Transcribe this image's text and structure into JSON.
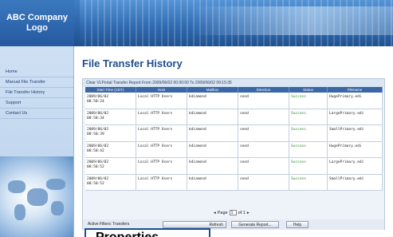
{
  "header": {
    "logo_text": "ABC Company\nLogo"
  },
  "sidebar": {
    "items": [
      {
        "label": "Home"
      },
      {
        "label": "Manual File Transfer"
      },
      {
        "label": "File Transfer History"
      },
      {
        "label": "Support"
      },
      {
        "label": "Contact Us"
      }
    ]
  },
  "main": {
    "title": "File Transfer History",
    "report_caption": "Clear VLPortal Transfer Report From 2009/06/02 00:00:00 To 2009/06/02 09:15:35",
    "columns": [
      "Start Time (CDT)",
      "Host",
      "Mailbox",
      "Direction",
      "Status",
      "Filename"
    ],
    "rows": [
      {
        "date": "2009/06/02",
        "time": "08:50:24",
        "host": "Local HTTP Users",
        "mailbox": "kdiamond",
        "direction": "send",
        "status": "Success",
        "filename": "HugePrimary.edi"
      },
      {
        "date": "2009/06/02",
        "time": "08:50:34",
        "host": "Local HTTP Users",
        "mailbox": "kdiamond",
        "direction": "send",
        "status": "Success",
        "filename": "LargePrimary.edi"
      },
      {
        "date": "2009/06/02",
        "time": "08:50:39",
        "host": "Local HTTP Users",
        "mailbox": "kdiamond",
        "direction": "send",
        "status": "Success",
        "filename": "SmallPrimary.edi"
      },
      {
        "date": "2009/06/02",
        "time": "08:50:42",
        "host": "Local HTTP Users",
        "mailbox": "kdiamond",
        "direction": "send",
        "status": "Success",
        "filename": "HugePrimary.edi"
      },
      {
        "date": "2009/06/02",
        "time": "08:50:52",
        "host": "Local HTTP Users",
        "mailbox": "kdiamond",
        "direction": "send",
        "status": "Success",
        "filename": "LargePrimary.edi"
      },
      {
        "date": "2009/06/02",
        "time": "08:50:52",
        "host": "Local HTTP Users",
        "mailbox": "kdiamond",
        "direction": "send",
        "status": "Success",
        "filename": "SmallPrimary.edi"
      }
    ],
    "pager": {
      "prefix": "Page",
      "current": "1",
      "suffix": "of 1"
    },
    "filters_label": "Active Filters: Transfers",
    "buttons": {
      "refresh": "Refresh",
      "generate": "Generate Report...",
      "help": "Help"
    }
  },
  "callout": {
    "text": "Properties"
  },
  "colors": {
    "header_blue": "#2b64a8",
    "title_blue": "#1f4f8d",
    "success_green": "#2e8b2e"
  }
}
